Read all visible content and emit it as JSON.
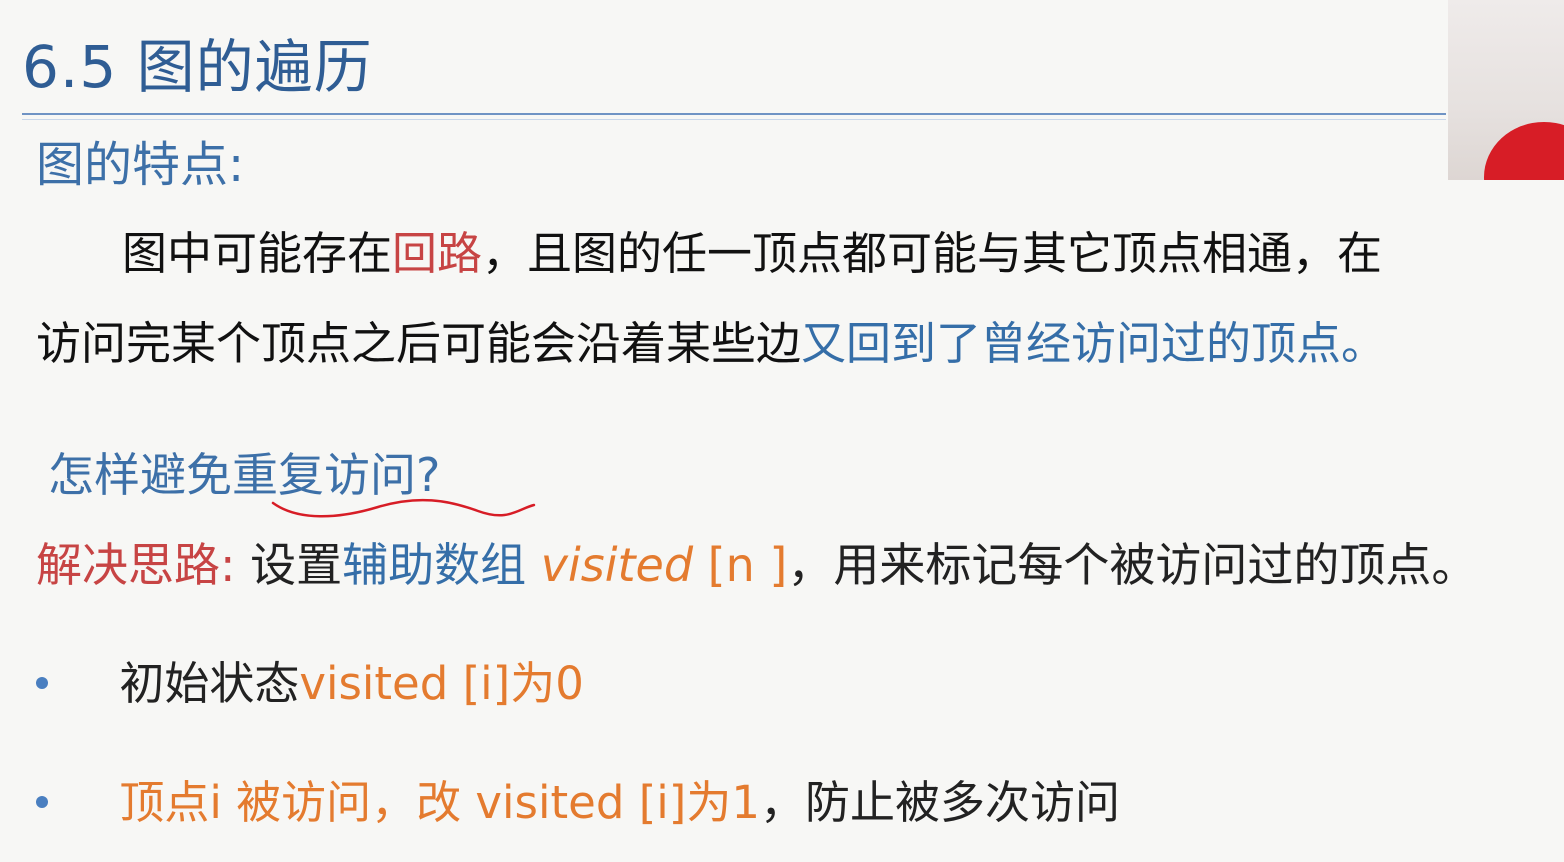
{
  "slide": {
    "title": "6.5 图的遍历"
  },
  "feature": {
    "heading": "图的特点:",
    "line1": {
      "part1": "图中可能存在",
      "part2": "回路",
      "part3": "，且图的任一顶点都可能与其它顶点相通，在"
    },
    "line2": {
      "part1": "访问完某个顶点之后可能会沿着某些边",
      "part2": "又回到了曾经访问过的顶点。"
    }
  },
  "question": {
    "text": "怎样避免重复访问?"
  },
  "solution": {
    "label": "解决思路:",
    "text1": " 设置",
    "aux": "辅助数组",
    "space": " ",
    "visited": "visited",
    "index": " [n ]",
    "text2": "，用来标记每个被访问过的顶点。"
  },
  "bullets": [
    {
      "part1": "初始状态",
      "part2": "visited [i]为0"
    },
    {
      "part1": "顶点i 被访问，改 visited [i]为1",
      "part2": "，防止被多次访问"
    }
  ],
  "colors": {
    "title_blue": "#2f5d94",
    "accent_blue": "#3d70a8",
    "highlight_red": "#c74444",
    "highlight_orange": "#e47b2f",
    "annotation_red": "#d71d26"
  }
}
